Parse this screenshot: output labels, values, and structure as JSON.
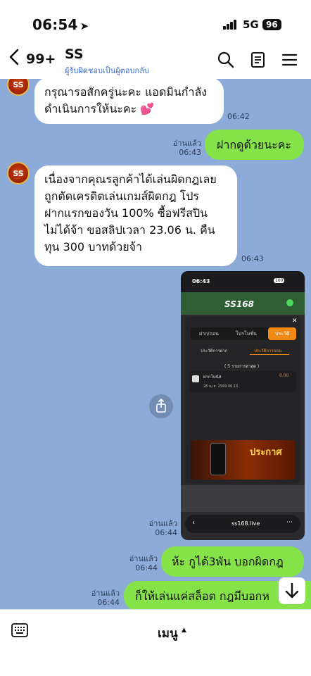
{
  "status": {
    "time": "06:54",
    "network": "5G",
    "battery": "96"
  },
  "header": {
    "back_count": "99+",
    "chat_name": "SS",
    "chat_subtitle": "ผู้รับผิดชอบเป็นผู้ตอบกลับ"
  },
  "avatar_text": "SS",
  "messages": [
    {
      "side": "in",
      "lines": [
        "กรุณารอสักครู่นะคะ แอดมินกำลัง",
        "ดำเนินการให้นะคะ 💕"
      ],
      "time": "06:42"
    },
    {
      "side": "out",
      "read": "อ่านแล้ว",
      "text": "ฝากดูด้วยนะคะ",
      "time": "06:43"
    },
    {
      "side": "in",
      "lines": [
        "เนื่องจากคุณรลูกค้าได้เล่นผิดกฎเลย",
        "ถูกตัดเครดิตเล่นเกมส์ผิดกฎ โปร",
        "ฝากแรกของวัน 100%  ซื้อฟรีสปิน",
        "ไม่ได้จ้า ขอสลิปเวลา 23.06 น. คืน",
        "ทุน 300 บาทด้วยจ้า"
      ],
      "time": "06:43"
    },
    {
      "side": "out",
      "read": "อ่านแล้ว",
      "type": "image",
      "time": "06:44"
    },
    {
      "side": "out",
      "read": "อ่านแล้ว",
      "text": "ห้ะ กูได้3พัน บอกผิดกฎ",
      "time": "06:44"
    },
    {
      "side": "out",
      "read": "อ่านแล้ว",
      "text": "ก็ให้เล่นแค่สล็อต กฎมีบอกห",
      "time": "06:44"
    }
  ],
  "screenshot": {
    "time": "06:43",
    "logo": "SS168",
    "tabs": [
      "ฝาก/ถอน",
      "โปรโมชั่น",
      "ประวัติ"
    ],
    "sub_tabs": [
      "ประวัติการฝาก",
      "ประวัติการถอน"
    ],
    "recent": "( 5 รายการล่าสุด )",
    "item_title": "ฝากโบนัส",
    "item_date": "28 เม.ย. 2569 00:15",
    "item_amount": "0.00",
    "banner_title": "ประกาศ",
    "url": "ss168.live"
  },
  "bottom": {
    "menu_label": "เมนู"
  },
  "colors": {
    "chat_bg": "#8cabd9",
    "outgoing": "#85e249",
    "incoming": "#ffffff",
    "accent": "#f08a15"
  }
}
